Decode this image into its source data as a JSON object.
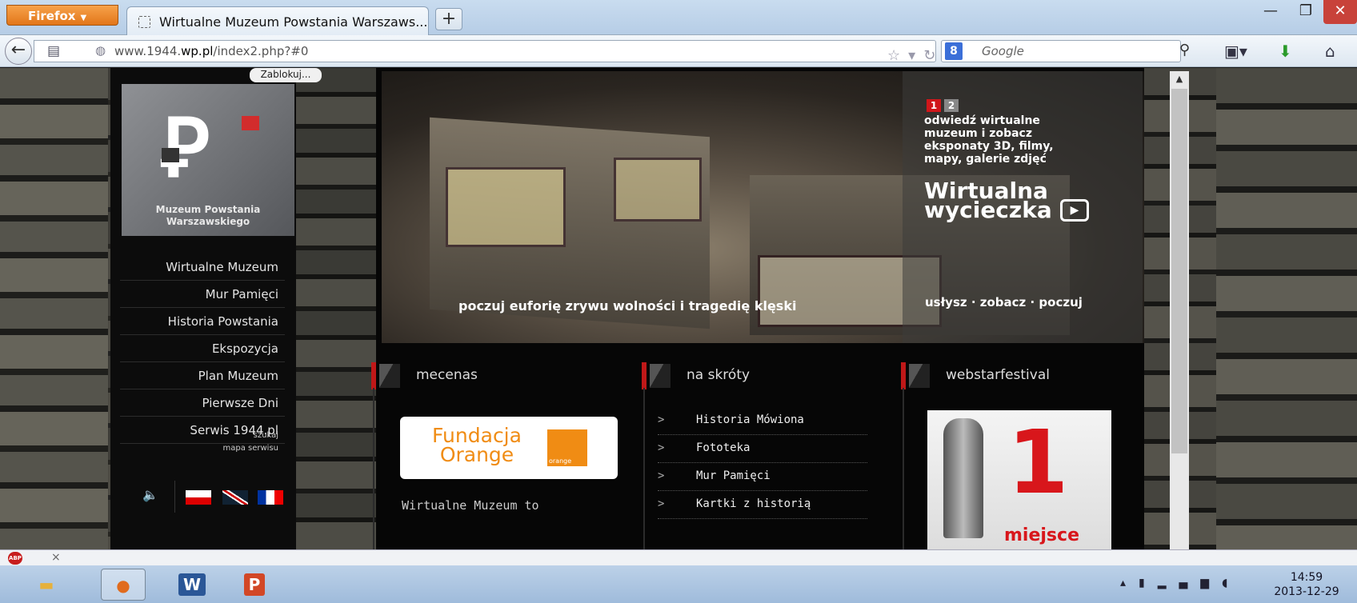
{
  "browser": {
    "firefox_label": "Firefox",
    "tab_title": "Wirtualne Muzeum Powstania Warszaws...",
    "new_tab": "+",
    "url_prefix": "www.1944.",
    "url_domain": "wp.pl",
    "url_suffix": "/index2.php?#0",
    "search_placeholder": "Google",
    "search_engine_badge": "8"
  },
  "page": {
    "zablokuj": "Zablokuj...",
    "logo_text": "Muzeum Powstania Warszawskiego",
    "menu": [
      "Wirtualne Muzeum",
      "Mur Pamięci",
      "Historia Powstania",
      "Ekspozycja",
      "Plan Muzeum",
      "Pierwsze Dni",
      "Serwis 1944.pl"
    ],
    "search_link": "szukaj",
    "sitemap_link": "mapa serwisu",
    "hero": {
      "slide_1": "1",
      "slide_2": "2",
      "promo_text": "odwiedź wirtualne muzeum i zobacz eksponaty 3D, filmy, mapy, galerie zdjęć",
      "tour_line1": "Wirtualna",
      "tour_line2": "wycieczka",
      "left_caption": "poczuj euforię zrywu wolności i tragedię klęski",
      "right_caption": "usłysz · zobacz · poczuj"
    },
    "columns": {
      "mecenas": "mecenas",
      "na_skroty": "na skróty",
      "webstar": "webstarfestival"
    },
    "fundacja_line1": "Fundacja",
    "fundacja_line2": "Orange",
    "orange_small": "orange",
    "wm_text": "Wirtualne Muzeum to",
    "shortcuts": [
      "Historia Mówiona",
      "Fototeka",
      "Mur Pamięci",
      "Kartki z historią"
    ],
    "award_number": "1",
    "award_text": "miejsce"
  },
  "taskbar": {
    "time": "14:59",
    "date": "2013-12-29"
  },
  "colors": {
    "accent_red": "#c01818",
    "firefox_orange": "#e2761a",
    "orange_brand": "#f08c14"
  }
}
